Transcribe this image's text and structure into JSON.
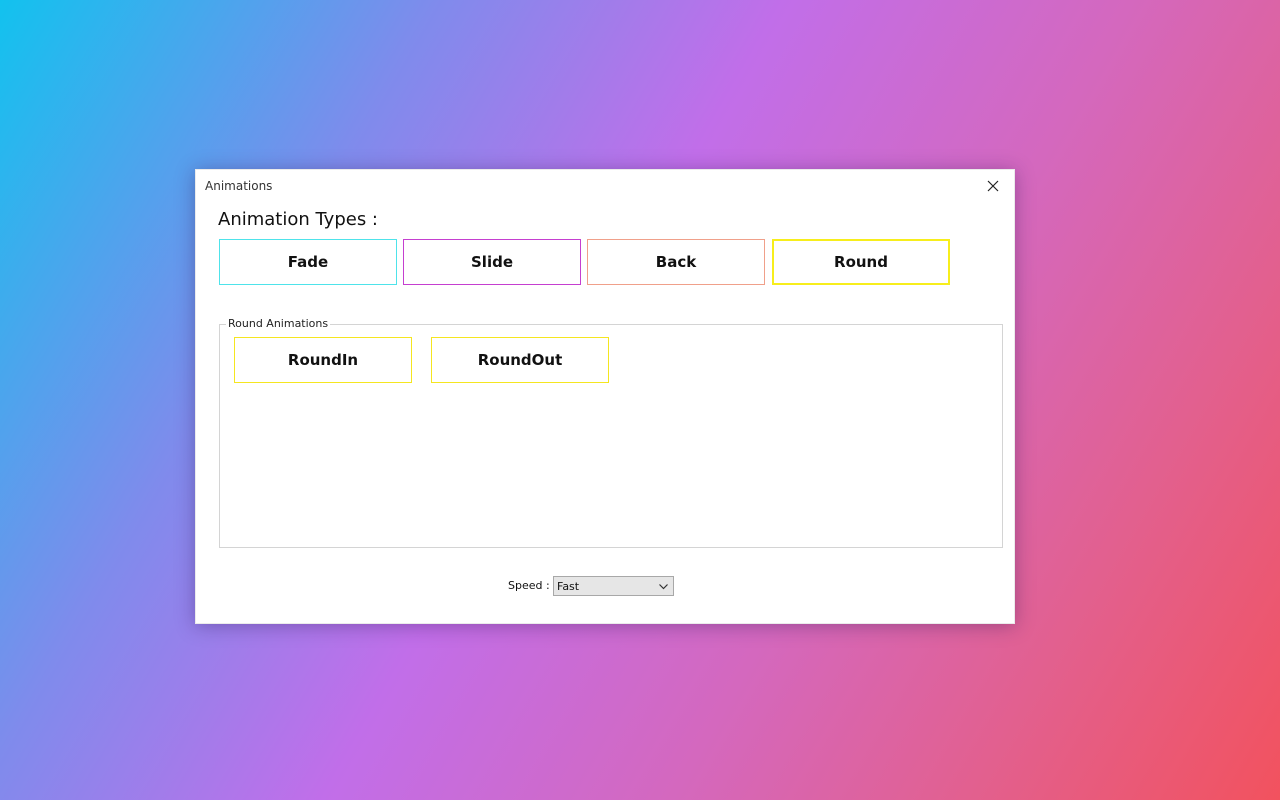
{
  "window": {
    "title": "Animations"
  },
  "section": {
    "title": "Animation Types :"
  },
  "types": [
    {
      "label": "Fade",
      "border_color": "#4ee3ea"
    },
    {
      "label": "Slide",
      "border_color": "#c53fd0"
    },
    {
      "label": "Back",
      "border_color": "#f0a08a"
    },
    {
      "label": "Round",
      "border_color": "#f7ee1c"
    }
  ],
  "group": {
    "legend": "Round Animations",
    "buttons": [
      {
        "label": "RoundIn"
      },
      {
        "label": "RoundOut"
      }
    ],
    "button_border_color": "#f5e620"
  },
  "speed": {
    "label": "Speed :",
    "value": "Fast"
  },
  "icons": {
    "close": "close-icon",
    "dropdown": "chevron-down-icon"
  }
}
